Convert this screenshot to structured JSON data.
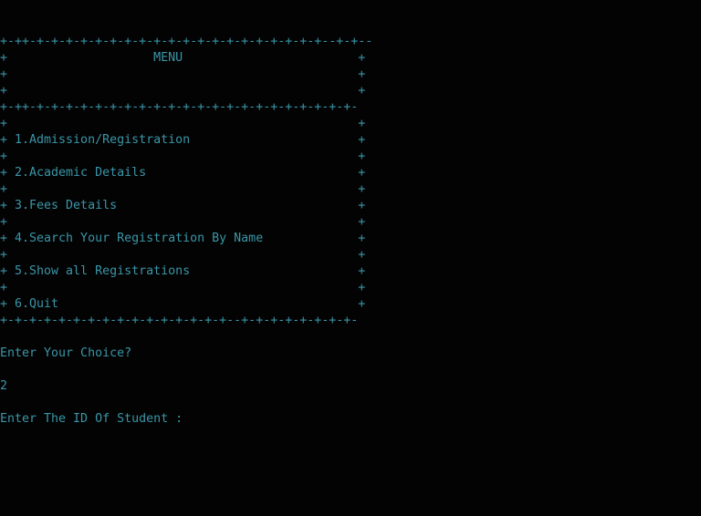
{
  "console": {
    "lines": [
      "+-++-+-+-+-+-+-+-+-+-+-+-+-+-+-+-+-+-+-+-+-+--+-+--",
      "+                    MENU                        +",
      "+                                                +",
      "+                                                +",
      "+-++-+-+-+-+-+-+-+-+-+-+-+-+-+-+-+-+-+-+-+-+-+-+-",
      "+                                                +",
      "+ 1.Admission/Registration                       +",
      "+                                                +",
      "+ 2.Academic Details                             +",
      "+                                                +",
      "+ 3.Fees Details                                 +",
      "+                                                +",
      "+ 4.Search Your Registration By Name             +",
      "+                                                +",
      "+ 5.Show all Registrations                       +",
      "+                                                +",
      "+ 6.Quit                                         +",
      "+-+-+-+-+-+-+-+-+-+-+-+-+-+-+-+--+-+-+-+-+-+-+-+-",
      "",
      "Enter Your Choice?",
      "",
      "2",
      "",
      "Enter The ID Of Student :"
    ]
  }
}
